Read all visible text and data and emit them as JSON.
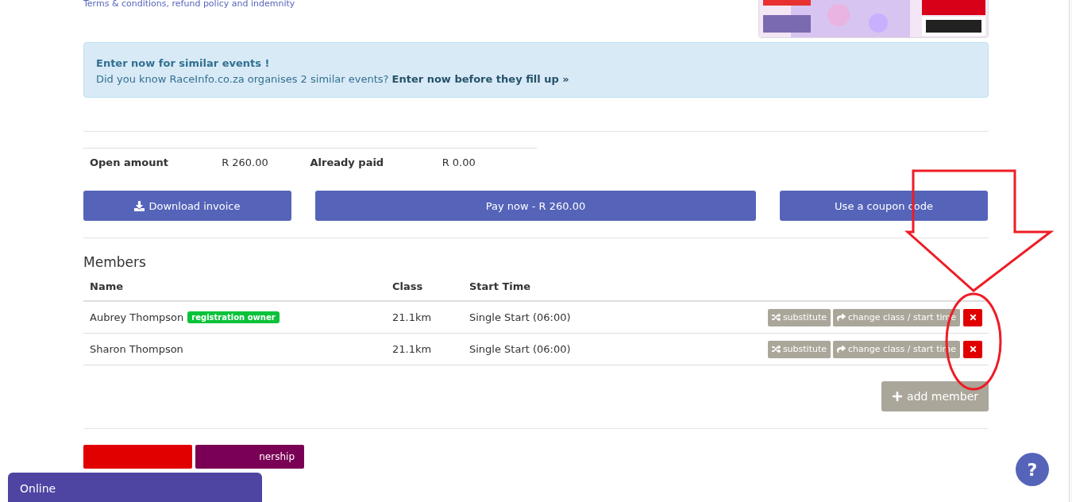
{
  "terms_link": "Terms & conditions, refund policy and indemnity",
  "alert": {
    "title": "Enter now for similar events !",
    "text": "Did you know RaceInfo.co.za organises 2 similar events?",
    "link": "Enter now before they fill up »"
  },
  "amounts": [
    {
      "label": "Open amount",
      "value": "R 260.00"
    },
    {
      "label": "Already paid",
      "value": "R 0.00"
    }
  ],
  "actions": [
    {
      "label": "Download invoice"
    },
    {
      "label": "Pay now - R 260.00"
    },
    {
      "label": "Use a coupon code"
    }
  ],
  "members": {
    "title": "Members",
    "columns": [
      "Name",
      "Class",
      "Start Time"
    ],
    "rows": [
      {
        "name": "Aubrey Thompson",
        "badge": "registration owner",
        "class": "21.1km",
        "start_time": "Single Start (06:00)",
        "substitute": "substitute",
        "change": "change class / start time"
      },
      {
        "name": "Sharon Thompson",
        "class": "21.1km",
        "start_time": "Single Start (06:00)",
        "substitute": "substitute",
        "change": "change class / start time"
      }
    ]
  },
  "add_member": "add member",
  "bottom_buttons": [
    {
      "kind": "danger"
    },
    {
      "kind": "transfer",
      "label": "nership"
    }
  ],
  "chat": {
    "label": "Online"
  },
  "help": {
    "label": "?"
  }
}
